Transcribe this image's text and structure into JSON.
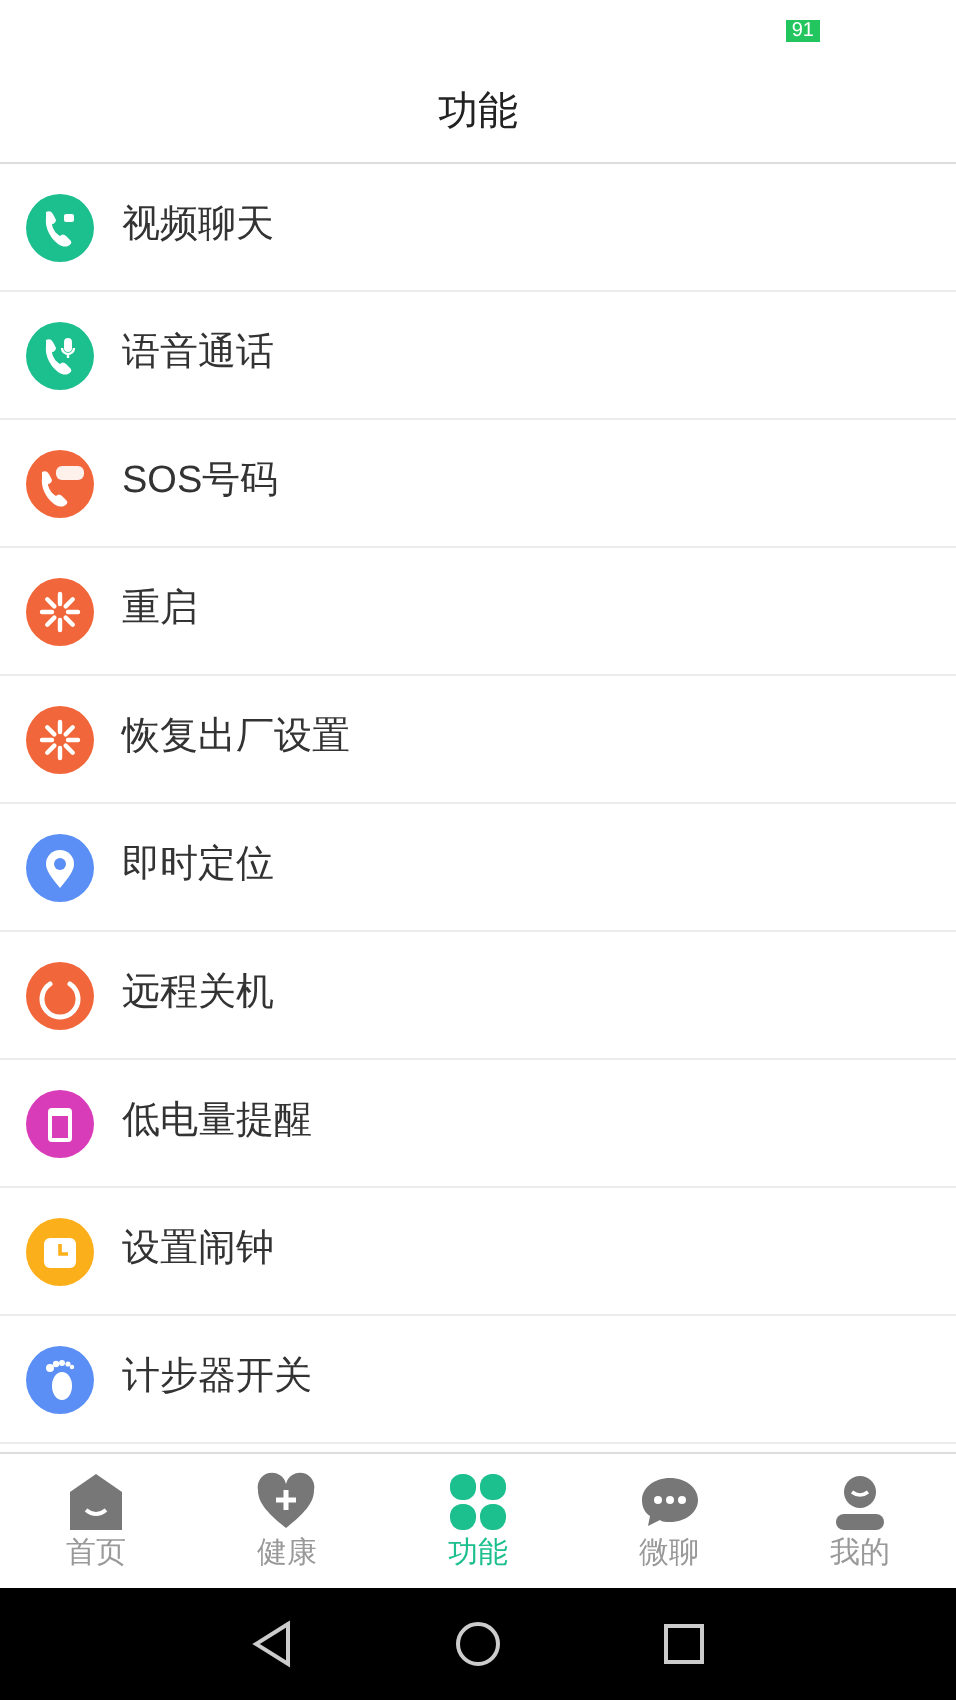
{
  "status_bar": {
    "battery": "91"
  },
  "header": {
    "title": "功能"
  },
  "items": [
    {
      "label": "视频聊天",
      "kind": "video-call"
    },
    {
      "label": "语音通话",
      "kind": "voice-call"
    },
    {
      "label": "SOS号码",
      "kind": "sos"
    },
    {
      "label": "重启",
      "kind": "restart"
    },
    {
      "label": "恢复出厂设置",
      "kind": "reset"
    },
    {
      "label": "即时定位",
      "kind": "location"
    },
    {
      "label": "远程关机",
      "kind": "power"
    },
    {
      "label": "低电量提醒",
      "kind": "battery"
    },
    {
      "label": "设置闹钟",
      "kind": "alarm"
    },
    {
      "label": "计步器开关",
      "kind": "pedometer"
    }
  ],
  "tab_bar": [
    {
      "label": "首页",
      "kind": "home",
      "selected": false
    },
    {
      "label": "健康",
      "kind": "health",
      "selected": false
    },
    {
      "label": "功能",
      "kind": "functions",
      "selected": true
    },
    {
      "label": "微聊",
      "kind": "chat",
      "selected": false
    },
    {
      "label": "我的",
      "kind": "profile",
      "selected": false
    }
  ]
}
